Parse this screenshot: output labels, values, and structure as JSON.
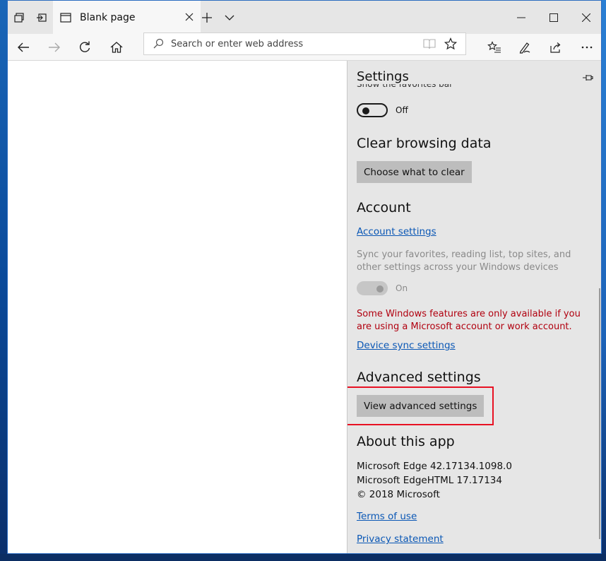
{
  "tab": {
    "title": "Blank page"
  },
  "address": {
    "placeholder": "Search or enter web address"
  },
  "settings": {
    "title": "Settings",
    "favorites_bar": {
      "label": "Show the favorites bar",
      "state": "Off"
    },
    "clear": {
      "heading": "Clear browsing data",
      "button": "Choose what to clear"
    },
    "account": {
      "heading": "Account",
      "link": "Account settings",
      "sync_text": "Sync your favorites, reading list, top sites, and other settings across your Windows devices",
      "sync_state": "On",
      "warning": "Some Windows features are only available if you are using a Microsoft account or work account.",
      "device_link": "Device sync settings"
    },
    "advanced": {
      "heading": "Advanced settings",
      "button": "View advanced settings"
    },
    "about": {
      "heading": "About this app",
      "line1": "Microsoft Edge 42.17134.1098.0",
      "line2": "Microsoft EdgeHTML 17.17134",
      "line3": "© 2018 Microsoft",
      "terms": "Terms of use",
      "privacy": "Privacy statement"
    }
  },
  "colors": {
    "link": "#0a57b5",
    "warning": "#b1000f",
    "highlight": "#e81123",
    "pane": "#e6e6e6"
  },
  "icons": [
    "tab-preview-icon",
    "set-aside-tabs-icon",
    "page-icon",
    "close-tab-icon",
    "new-tab-icon",
    "tab-list-icon",
    "minimize-icon",
    "maximize-icon",
    "close-window-icon",
    "back-icon",
    "forward-icon",
    "refresh-icon",
    "home-icon",
    "search-icon",
    "reading-view-icon",
    "favorite-star-icon",
    "favorites-hub-icon",
    "web-note-icon",
    "share-icon",
    "more-icon",
    "pin-icon"
  ]
}
